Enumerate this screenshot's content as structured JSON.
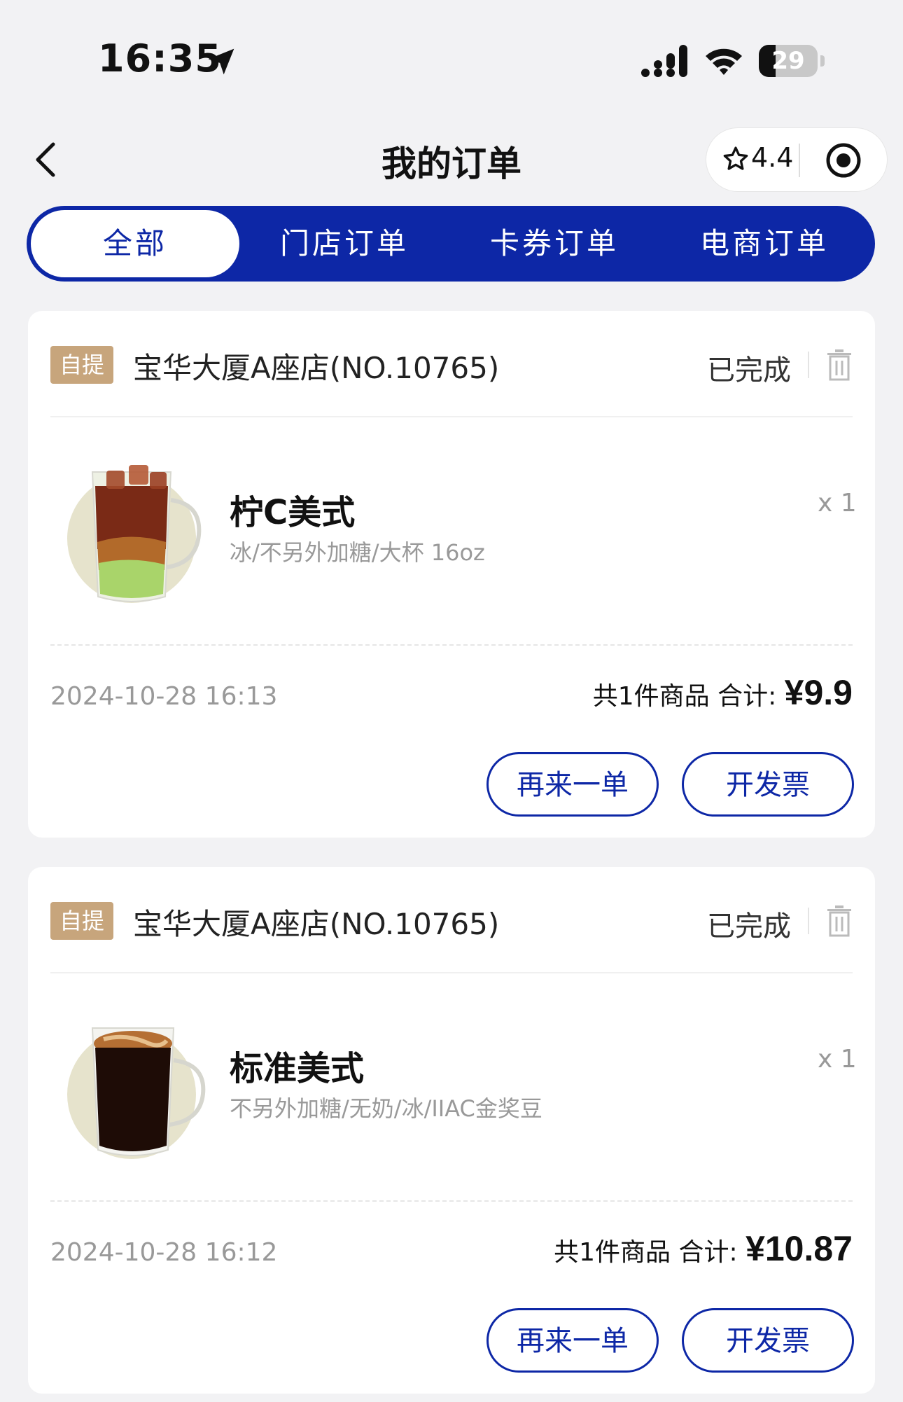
{
  "status_bar": {
    "time": "16:35",
    "battery": "29",
    "battery_level": 0.29
  },
  "header": {
    "title": "我的订单",
    "rating": "4.4"
  },
  "tabs": [
    {
      "label": "全部",
      "active": true
    },
    {
      "label": "门店订单",
      "active": false
    },
    {
      "label": "卡券订单",
      "active": false
    },
    {
      "label": "电商订单",
      "active": false
    }
  ],
  "orders": [
    {
      "tag": "自提",
      "store": "宝华大厦A座店(NO.10765)",
      "status": "已完成",
      "product_name": "柠C美式",
      "product_spec": "冰/不另外加糖/大杯 16oz",
      "qty": "x 1",
      "date": "2024-10-28 16:13",
      "summary_label": "共1件商品  合计: ",
      "price": "¥9.9",
      "reorder_label": "再来一单",
      "invoice_label": "开发票"
    },
    {
      "tag": "自提",
      "store": "宝华大厦A座店(NO.10765)",
      "status": "已完成",
      "product_name": "标准美式",
      "product_spec": "不另外加糖/无奶/冰/IIAC金奖豆",
      "qty": "x 1",
      "date": "2024-10-28 16:12",
      "summary_label": "共1件商品  合计: ",
      "price": "¥10.87",
      "reorder_label": "再来一单",
      "invoice_label": "开发票"
    }
  ],
  "colors": {
    "brand": "#0d27a6",
    "tag": "#c7a57c",
    "background": "#f2f2f4"
  },
  "icons": [
    "location-arrow-icon",
    "signal-icon",
    "wifi-icon",
    "battery-icon",
    "back-arrow-icon",
    "star-icon",
    "target-icon",
    "trash-icon"
  ]
}
